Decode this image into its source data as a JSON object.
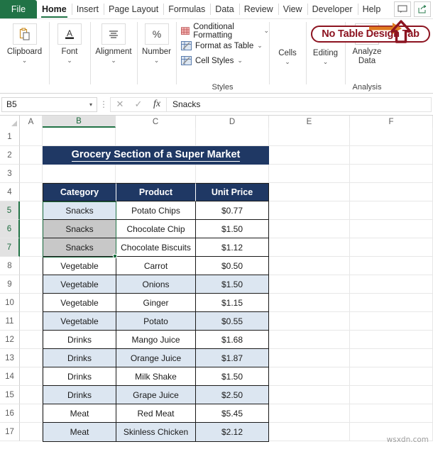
{
  "tabs": {
    "file": "File",
    "items": [
      {
        "label": "Home",
        "active": true
      },
      {
        "label": "Insert",
        "active": false
      },
      {
        "label": "Page Layout",
        "active": false
      },
      {
        "label": "Formulas",
        "active": false
      },
      {
        "label": "Data",
        "active": false
      },
      {
        "label": "Review",
        "active": false
      },
      {
        "label": "View",
        "active": false
      },
      {
        "label": "Developer",
        "active": false
      },
      {
        "label": "Help",
        "active": false
      }
    ]
  },
  "ribbon": {
    "clipboard": {
      "label": "Clipboard",
      "icon": "clipboard-icon",
      "caret": "⌄"
    },
    "font": {
      "label": "Font",
      "icon": "font-underline-icon",
      "caret": "⌄"
    },
    "alignment": {
      "label": "Alignment",
      "icon": "align-center-icon",
      "caret": "⌄"
    },
    "number": {
      "label": "Number",
      "icon": "percent-icon",
      "caret": "⌄"
    },
    "styles": {
      "footer": "Styles",
      "items": [
        {
          "label": "Conditional Formatting",
          "icon": "conditional-formatting-icon",
          "caret": "⌄"
        },
        {
          "label": "Format as Table",
          "icon": "format-as-table-icon",
          "caret": "⌄"
        },
        {
          "label": "Cell Styles",
          "icon": "cell-styles-icon",
          "caret": "⌄"
        }
      ]
    },
    "cells": {
      "label": "Cells",
      "caret": "⌄"
    },
    "editing": {
      "label": "Editing",
      "caret": "⌄"
    },
    "analysis": {
      "label": "Analyze Data",
      "footer": "Analysis",
      "icon": "analyze-data-icon"
    }
  },
  "annotation": {
    "text": "No Table Design Tab",
    "color": "#8c1320",
    "arrow_color": "#e07b20"
  },
  "formula_bar": {
    "name_box": "B5",
    "name_box_caret": "▾",
    "cancel_icon": "✕",
    "enter_icon": "✓",
    "fx_icon": "fx",
    "value": "Snacks",
    "more_icon": "⋮"
  },
  "sheet": {
    "columns": [
      "A",
      "B",
      "C",
      "D",
      "E",
      "F"
    ],
    "selected_column": "B",
    "rows": [
      "1",
      "2",
      "3",
      "4",
      "5",
      "6",
      "7",
      "8",
      "9",
      "10",
      "11",
      "12",
      "13",
      "14",
      "15",
      "16",
      "17"
    ],
    "selected_rows": [
      "5",
      "6",
      "7"
    ]
  },
  "table": {
    "title": "Grocery Section of  a Super Market",
    "headers": [
      "Category",
      "Product",
      "Unit Price"
    ],
    "rows": [
      {
        "category": "Snacks",
        "product": "Potato Chips",
        "price": "$0.77",
        "band": "active"
      },
      {
        "category": "Snacks",
        "product": "Chocolate Chip",
        "price": "$1.50",
        "band": "selected"
      },
      {
        "category": "Snacks",
        "product": "Chocolate Biscuits",
        "price": "$1.12",
        "band": "selected"
      },
      {
        "category": "Vegetable",
        "product": "Carrot",
        "price": "$0.50",
        "band": "light"
      },
      {
        "category": "Vegetable",
        "product": "Onions",
        "price": "$1.50",
        "band": "blue"
      },
      {
        "category": "Vegetable",
        "product": "Ginger",
        "price": "$1.15",
        "band": "light"
      },
      {
        "category": "Vegetable",
        "product": "Potato",
        "price": "$0.55",
        "band": "blue"
      },
      {
        "category": "Drinks",
        "product": "Mango Juice",
        "price": "$1.68",
        "band": "light"
      },
      {
        "category": "Drinks",
        "product": "Orange Juice",
        "price": "$1.87",
        "band": "blue"
      },
      {
        "category": "Drinks",
        "product": "Milk Shake",
        "price": "$1.50",
        "band": "light"
      },
      {
        "category": "Drinks",
        "product": "Grape Juice",
        "price": "$2.50",
        "band": "blue"
      },
      {
        "category": "Meat",
        "product": "Red Meat",
        "price": "$5.45",
        "band": "light"
      },
      {
        "category": "Meat",
        "product": "Skinless Chicken",
        "price": "$2.12",
        "band": "blue"
      }
    ]
  },
  "watermark": "wsxdn.com",
  "colors": {
    "header_navy": "#1f3864",
    "band_blue": "#dce6f1",
    "excel_green": "#217346",
    "annotation_red": "#8c1320"
  }
}
